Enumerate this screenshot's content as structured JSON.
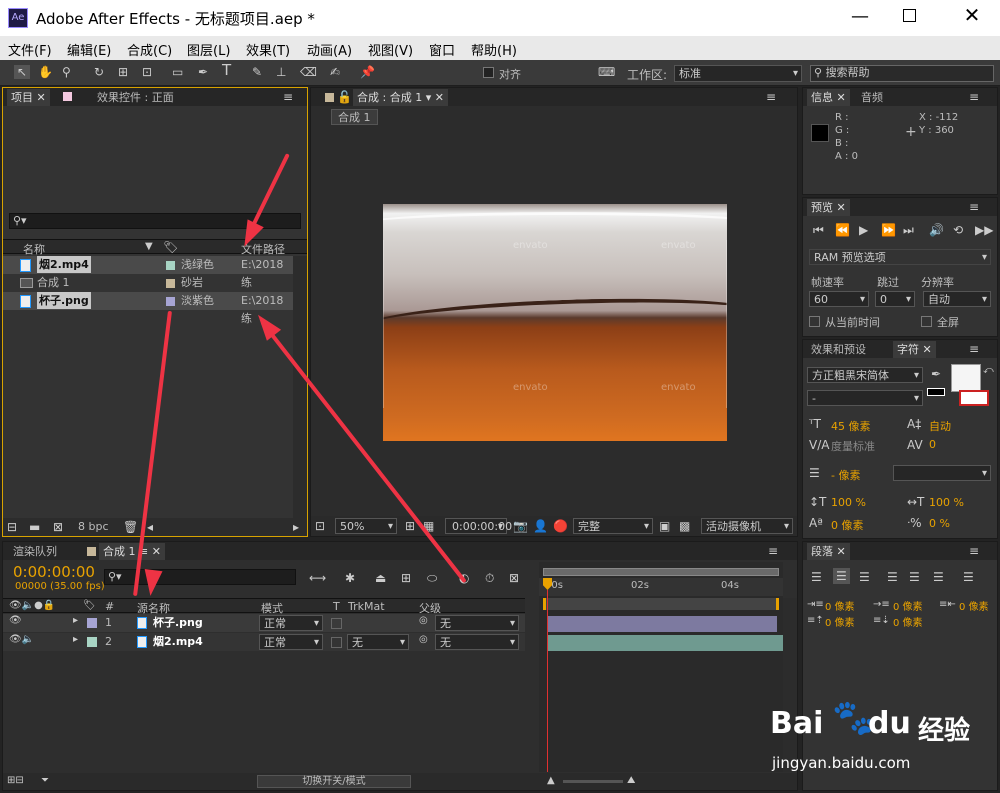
{
  "title": {
    "app_icon": "Ae",
    "text": "Adobe After Effects - 无标题项目.aep *"
  },
  "menu": [
    "文件(F)",
    "编辑(E)",
    "合成(C)",
    "图层(L)",
    "效果(T)",
    "动画(A)",
    "视图(V)",
    "窗口",
    "帮助(H)"
  ],
  "toolbar": {
    "snap_label": "对齐",
    "workspace_label": "工作区:",
    "workspace_value": "标准",
    "search_help": "搜索帮助"
  },
  "project": {
    "tab_project": "项目",
    "tab_effects": "效果控件 : 正面",
    "col_name": "名称",
    "col_path": "文件路径",
    "items": [
      {
        "name": "烟2.mp4",
        "label": "浅绿色",
        "path": "E:\\2018练",
        "color": "#a8d4c4",
        "icon": "video-file-icon"
      },
      {
        "name": "合成 1",
        "label": "砂岩",
        "path": "",
        "color": "#c7b89a",
        "icon": "composition-icon"
      },
      {
        "name": "杯子.png",
        "label": "淡紫色",
        "path": "E:\\2018练",
        "color": "#a7a5d4",
        "icon": "image-file-icon"
      }
    ],
    "bpc": "8 bpc"
  },
  "comp_viewer": {
    "tab": "合成 : 合成 1",
    "breadcrumb": "合成 1",
    "zoom": "50%",
    "time": "0:00:00:00",
    "quality": "完整",
    "camera": "活动摄像机",
    "watermark": "envato"
  },
  "info": {
    "tab_info": "信息",
    "tab_audio": "音频",
    "r": "R :",
    "g": "G :",
    "b": "B :",
    "a": "A : 0",
    "x": "X : -112",
    "y": "Y : 360"
  },
  "preview": {
    "tab": "预览",
    "ram": "RAM 预览选项",
    "fps_label": "帧速率",
    "skip_label": "跳过",
    "res_label": "分辨率",
    "fps": "60",
    "skip": "0",
    "res": "自动",
    "from_current": "从当前时间",
    "fullscreen": "全屏"
  },
  "character": {
    "tab_effects": "效果和预设",
    "tab_char": "字符",
    "font": "方正粗黑宋简体",
    "style": "-",
    "size": "45 像素",
    "leading": "自动",
    "kerning": "度量标准",
    "tracking": "0",
    "stroke": "- 像素",
    "vscale": "100 %",
    "hscale": "100 %",
    "baseline": "0 像素",
    "tsume": "0 %"
  },
  "paragraph": {
    "tab": "段落",
    "indent1": "0 像素",
    "indent2": "0 像素",
    "indent3": "0 像素",
    "space1": "0 像素",
    "space2": "0 像素"
  },
  "timeline": {
    "tab_render": "渲染队列",
    "tab_comp": "合成 1",
    "timecode": "0:00:00:00",
    "frames": "00000 (35.00 fps)",
    "col_num": "#",
    "col_source": "源名称",
    "col_mode": "模式",
    "col_t": "T",
    "col_trkmat": "TrkMat",
    "col_parent": "父级",
    "ruler": [
      "00s",
      "02s",
      "04s"
    ],
    "layers": [
      {
        "num": "1",
        "name": "杯子.png",
        "mode": "正常",
        "trkmat": "",
        "parent": "无",
        "color": "#a7a5d4",
        "bar_color": "#7d7aa0"
      },
      {
        "num": "2",
        "name": "烟2.mp4",
        "mode": "正常",
        "trkmat": "无",
        "parent": "无",
        "color": "#a8d4c4",
        "bar_color": "#6f9a90"
      }
    ],
    "footer": "切换开关/模式"
  },
  "baidu": {
    "logo": "Bai",
    "logo2": "du",
    "jingyan": "经验",
    "url": "jingyan.baidu.com"
  }
}
